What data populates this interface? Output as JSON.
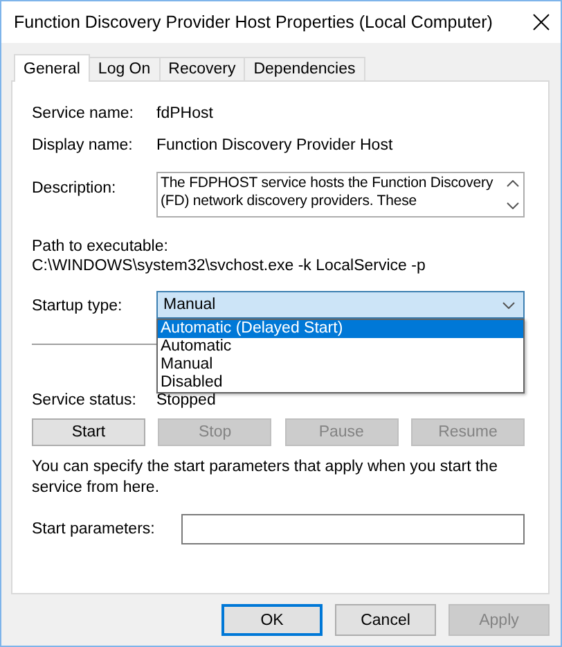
{
  "window": {
    "title": "Function Discovery Provider Host Properties (Local Computer)"
  },
  "tabs": [
    {
      "label": "General",
      "selected": true
    },
    {
      "label": "Log On",
      "selected": false
    },
    {
      "label": "Recovery",
      "selected": false
    },
    {
      "label": "Dependencies",
      "selected": false
    }
  ],
  "service_name": {
    "label": "Service name:",
    "value": "fdPHost"
  },
  "display_name": {
    "label": "Display name:",
    "value": "Function Discovery Provider Host"
  },
  "description": {
    "label": "Description:",
    "value": "The FDPHOST service hosts the Function Discovery (FD) network discovery providers. These"
  },
  "path": {
    "label": "Path to executable:",
    "value": "C:\\WINDOWS\\system32\\svchost.exe -k LocalService -p"
  },
  "startup_type": {
    "label": "Startup type:",
    "value": "Manual",
    "expanded": true,
    "options": [
      {
        "label": "Automatic (Delayed Start)",
        "highlighted": true
      },
      {
        "label": "Automatic",
        "highlighted": false
      },
      {
        "label": "Manual",
        "highlighted": false
      },
      {
        "label": "Disabled",
        "highlighted": false
      }
    ]
  },
  "service_status": {
    "label": "Service status:",
    "value": "Stopped"
  },
  "service_buttons": [
    {
      "label": "Start",
      "disabled": false
    },
    {
      "label": "Stop",
      "disabled": true
    },
    {
      "label": "Pause",
      "disabled": true
    },
    {
      "label": "Resume",
      "disabled": true
    }
  ],
  "hint": "You can specify the start parameters that apply when you start the service from here.",
  "start_parameters": {
    "label": "Start parameters:"
  },
  "dialog_buttons": [
    {
      "label": "OK",
      "default": true,
      "disabled": false
    },
    {
      "label": "Cancel",
      "default": false,
      "disabled": false
    },
    {
      "label": "Apply",
      "default": false,
      "disabled": true
    }
  ]
}
